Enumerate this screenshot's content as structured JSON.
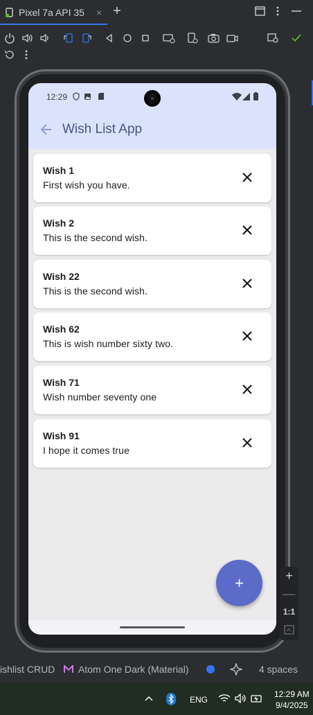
{
  "ide": {
    "tab_title": "Pixel 7a API 35",
    "tab_close": "×",
    "add_tab": "+",
    "status": {
      "project": "ishlist CRUD",
      "theme": "Atom One Dark (Material)",
      "indent": "4 spaces"
    },
    "zoom": {
      "plus": "+",
      "minus": "—",
      "ratio": "1:1"
    }
  },
  "device": {
    "status_time": "12:29",
    "appbar_title": "Wish List App",
    "fab_label": "+"
  },
  "wishes": [
    {
      "title": "Wish 1",
      "description": "First wish you have."
    },
    {
      "title": "Wish 2",
      "description": "This is the second wish."
    },
    {
      "title": "Wish 22",
      "description": "This is the second wish."
    },
    {
      "title": "Wish 62",
      "description": "This is wish number sixty two."
    },
    {
      "title": "Wish 71",
      "description": "Wish number seventy one"
    },
    {
      "title": "Wish 91",
      "description": "I hope it comes true"
    }
  ],
  "taskbar": {
    "lang": "ENG",
    "time": "12:29 AM",
    "date": "9/4/2025"
  },
  "colors": {
    "accent": "#3574f0",
    "appbar_bg": "#dbe2fb",
    "fab": "#5b6bc7"
  }
}
